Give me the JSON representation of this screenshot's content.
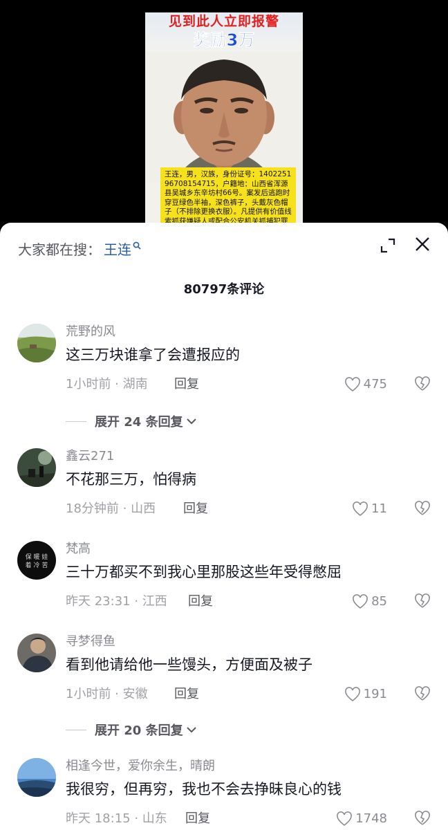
{
  "poster": {
    "alert_text": "见到此人立即报警",
    "reward_text": "奖励3万",
    "notice_text": "王连，男，汉族，身份证号：140225196708154715，户籍地：山西省浑源县吴城乡东辛坊村66号。案发后逃跑时穿豆绿色半袖，深色裤子，头戴灰色帽子（不排除更换衣服）。凡提供有价值线索抓获嫌疑人或配合公安机关抓捕犯罪嫌疑"
  },
  "search_bar": {
    "prefix": "大家都在搜：",
    "term": "王连"
  },
  "comment_count_title": "80797条评论",
  "comments": [
    {
      "username": "荒野的风",
      "text": "这三万块谁拿了会遭报应的",
      "time_location": "1小时前 · 湖南",
      "reply_label": "回复",
      "likes": "475"
    },
    {
      "username": "鑫云271",
      "text": "不花那三万，怕得病",
      "time_location": "18分钟前 · 山西",
      "reply_label": "回复",
      "likes": "11"
    },
    {
      "username": "梵高",
      "text": "三十万都买不到我心里那股这些年受得憋屈",
      "time_location": "昨天 23:31 · 江西",
      "reply_label": "回复",
      "likes": "85"
    },
    {
      "username": "寻梦得鱼",
      "text": "看到他请给他一些馒头，方便面及被子",
      "time_location": "1小时前 · 安徽",
      "reply_label": "回复",
      "likes": "191"
    },
    {
      "username": "相逢今世，爱你余生，晴朗",
      "text": "我很穷，但再穷，我也不会去挣昧良心的钱",
      "time_location": "昨天 18:15 · 山东",
      "reply_label": "回复",
      "likes": "1748"
    }
  ],
  "expand_replies": [
    {
      "label": "展开 24 条回复"
    },
    {
      "label": "展开 20 条回复"
    }
  ],
  "colors": {
    "alert_red": "#e32020",
    "reward_blue": "#1d4fd6",
    "notice_yellow": "#f6e11a",
    "search_link_blue": "#2a5caa"
  },
  "icons": {
    "search": "magnifier",
    "expand": "corner-brackets",
    "close": "x-mark",
    "like": "heart-outline",
    "dislike": "broken-heart-outline",
    "expand_chevron": "chevron-down"
  }
}
